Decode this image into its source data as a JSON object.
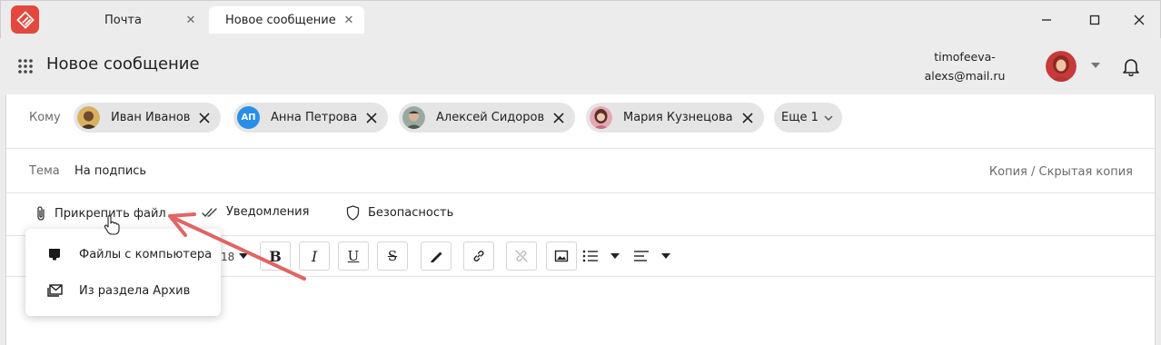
{
  "tabs": [
    {
      "label": "Почта",
      "active": false
    },
    {
      "label": "Новое сообщение",
      "active": true
    }
  ],
  "header": {
    "title": "Новое сообщение",
    "account_email": "timofeeva-alexs@mail.ru"
  },
  "recipients": {
    "label": "Кому",
    "chips": [
      {
        "name": "Иван Иванов",
        "avatar": "photo"
      },
      {
        "name": "Анна Петрова",
        "avatar": "initials",
        "initials": "АП"
      },
      {
        "name": "Алексей Сидоров",
        "avatar": "photo"
      },
      {
        "name": "Мария Кузнецова",
        "avatar": "photo"
      }
    ],
    "more_label": "Еще 1"
  },
  "subject": {
    "label": "Тема",
    "value": "На подпись",
    "cc_link": "Копия / Скрытая копия"
  },
  "actions": {
    "attach": "Прикрепить файл",
    "notifications": "Уведомления",
    "security": "Безопасность"
  },
  "toolbar": {
    "font_size": "18"
  },
  "attach_menu": {
    "items": [
      {
        "label": "Файлы с компьютера",
        "icon": "monitor-icon"
      },
      {
        "label": "Из раздела Архив",
        "icon": "archive-mail-icon"
      }
    ]
  },
  "colors": {
    "brand": "#e2483d",
    "chip_bg": "#e5e5e5",
    "annotation_arrow": "#e06565",
    "initials_avatar": "#2a8ee8"
  }
}
